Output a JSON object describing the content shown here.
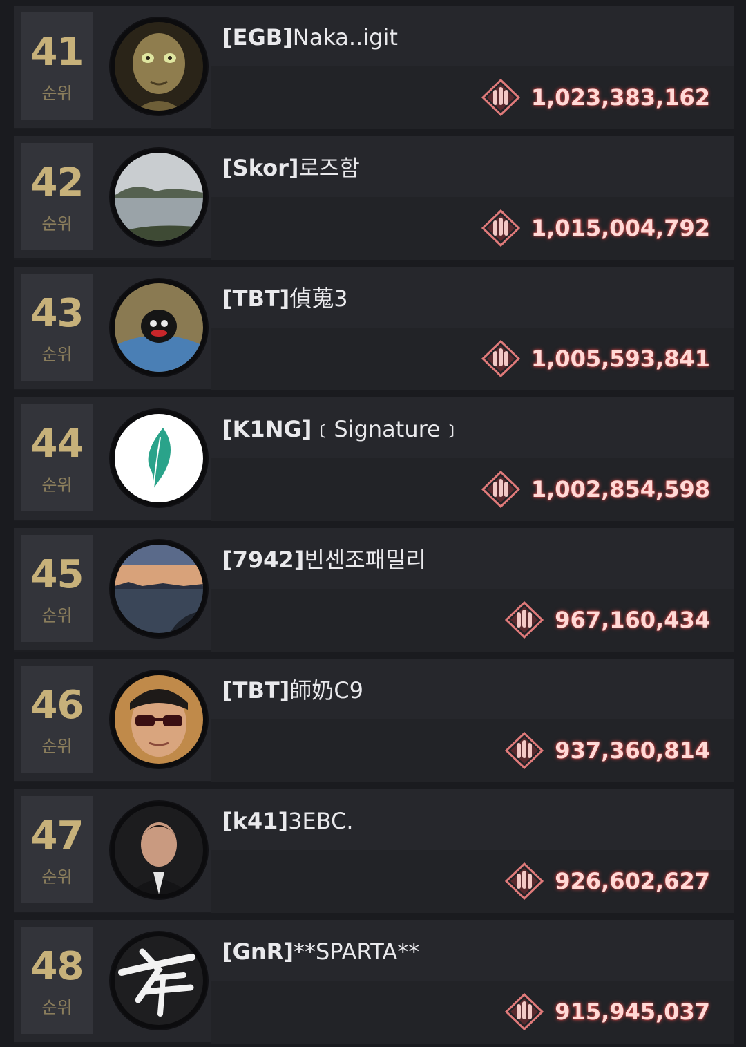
{
  "rank_suffix": "순위",
  "colors": {
    "rank_number": "#c7b17a",
    "score_text": "#ffd9d6",
    "score_glow": "#e65050",
    "row_bg": "#26272c"
  },
  "rows": [
    {
      "rank": "41",
      "tag": "[EGB]",
      "name": "Naka..igit",
      "score": "1,023,383,162",
      "avatar": "goblin-avatar-icon"
    },
    {
      "rank": "42",
      "tag": "[Skor]",
      "name": "로즈함",
      "score": "1,015,004,792",
      "avatar": "sea-island-avatar-icon"
    },
    {
      "rank": "43",
      "tag": "[TBT]",
      "name": "偵蒐3",
      "score": "1,005,593,841",
      "avatar": "plush-doll-avatar-icon"
    },
    {
      "rank": "44",
      "tag": "[K1NG]",
      "name": "﹝Signature﹞",
      "score": "1,002,854,598",
      "avatar": "feather-avatar-icon"
    },
    {
      "rank": "45",
      "tag": "[7942]",
      "name": "빈센조패밀리",
      "score": "967,160,434",
      "avatar": "sunset-sea-avatar-icon"
    },
    {
      "rank": "46",
      "tag": "[TBT]",
      "name": "師奶C9",
      "score": "937,360,814",
      "avatar": "sunglasses-man-avatar-icon"
    },
    {
      "rank": "47",
      "tag": "[k41]",
      "name": "3EBC.",
      "score": "926,602,627",
      "avatar": "soldier-portrait-avatar-icon"
    },
    {
      "rank": "48",
      "tag": "[GnR]",
      "name": "**SPARTA**",
      "score": "915,945,037",
      "avatar": "calligraphy-avatar-icon"
    }
  ]
}
